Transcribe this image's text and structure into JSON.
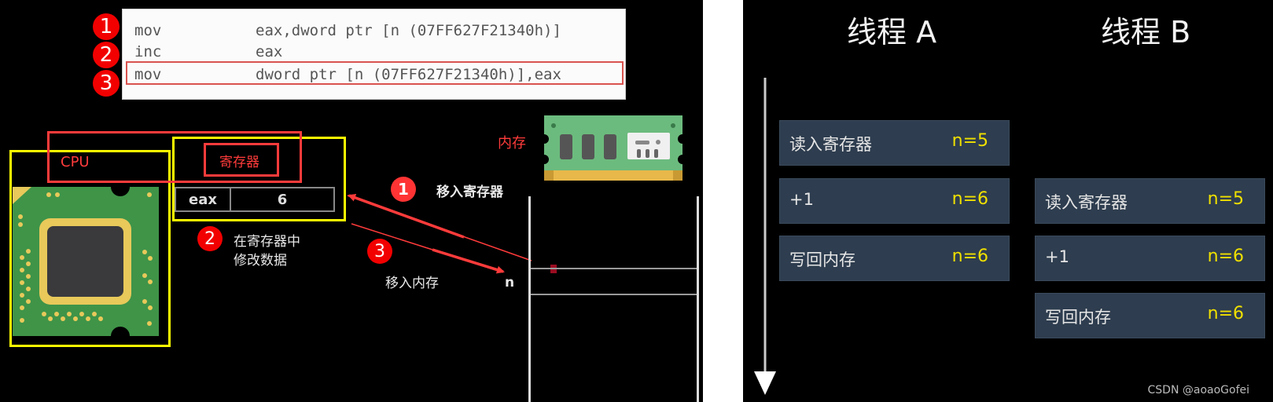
{
  "left_panel": {
    "code": {
      "lines": [
        {
          "num": "1",
          "op": "mov",
          "args": "eax,dword ptr [n (07FF627F21340h)]"
        },
        {
          "num": "2",
          "op": "inc",
          "args": "eax"
        },
        {
          "num": "3",
          "op": "mov",
          "args": "dword ptr [n (07FF627F21340h)],eax"
        }
      ],
      "highlighted_line": 3
    },
    "cpu_label": "CPU",
    "register_label": "寄存器",
    "register": {
      "name": "eax",
      "value": "6"
    },
    "memory_label": "内存",
    "memory_cell_label": "n",
    "steps": [
      {
        "num": "1",
        "text": "移入寄存器"
      },
      {
        "num": "2",
        "text_line1": "在寄存器中",
        "text_line2": "修改数据"
      },
      {
        "num": "3",
        "text": "移入内存"
      }
    ],
    "colors": {
      "highlight_red": "#ff3b3b",
      "frame_yellow": "#ffff00",
      "badge_red": "#f20000"
    }
  },
  "right_panel": {
    "threads": [
      {
        "title": "线程 A",
        "steps": [
          {
            "label": "读入寄存器",
            "value": "n=5"
          },
          {
            "label": "+1",
            "value": "n=6"
          },
          {
            "label": "写回内存",
            "value": "n=6"
          }
        ]
      },
      {
        "title": "线程 B",
        "steps": [
          {
            "label": "读入寄存器",
            "value": "n=5"
          },
          {
            "label": "+1",
            "value": "n=6"
          },
          {
            "label": "写回内存",
            "value": "n=6"
          }
        ]
      }
    ],
    "timeline": "time-arrow-down",
    "colors": {
      "step_bg": "#2e3d4f",
      "value_yellow": "#f0e000"
    }
  },
  "watermark": "CSDN @aoaoGofei"
}
